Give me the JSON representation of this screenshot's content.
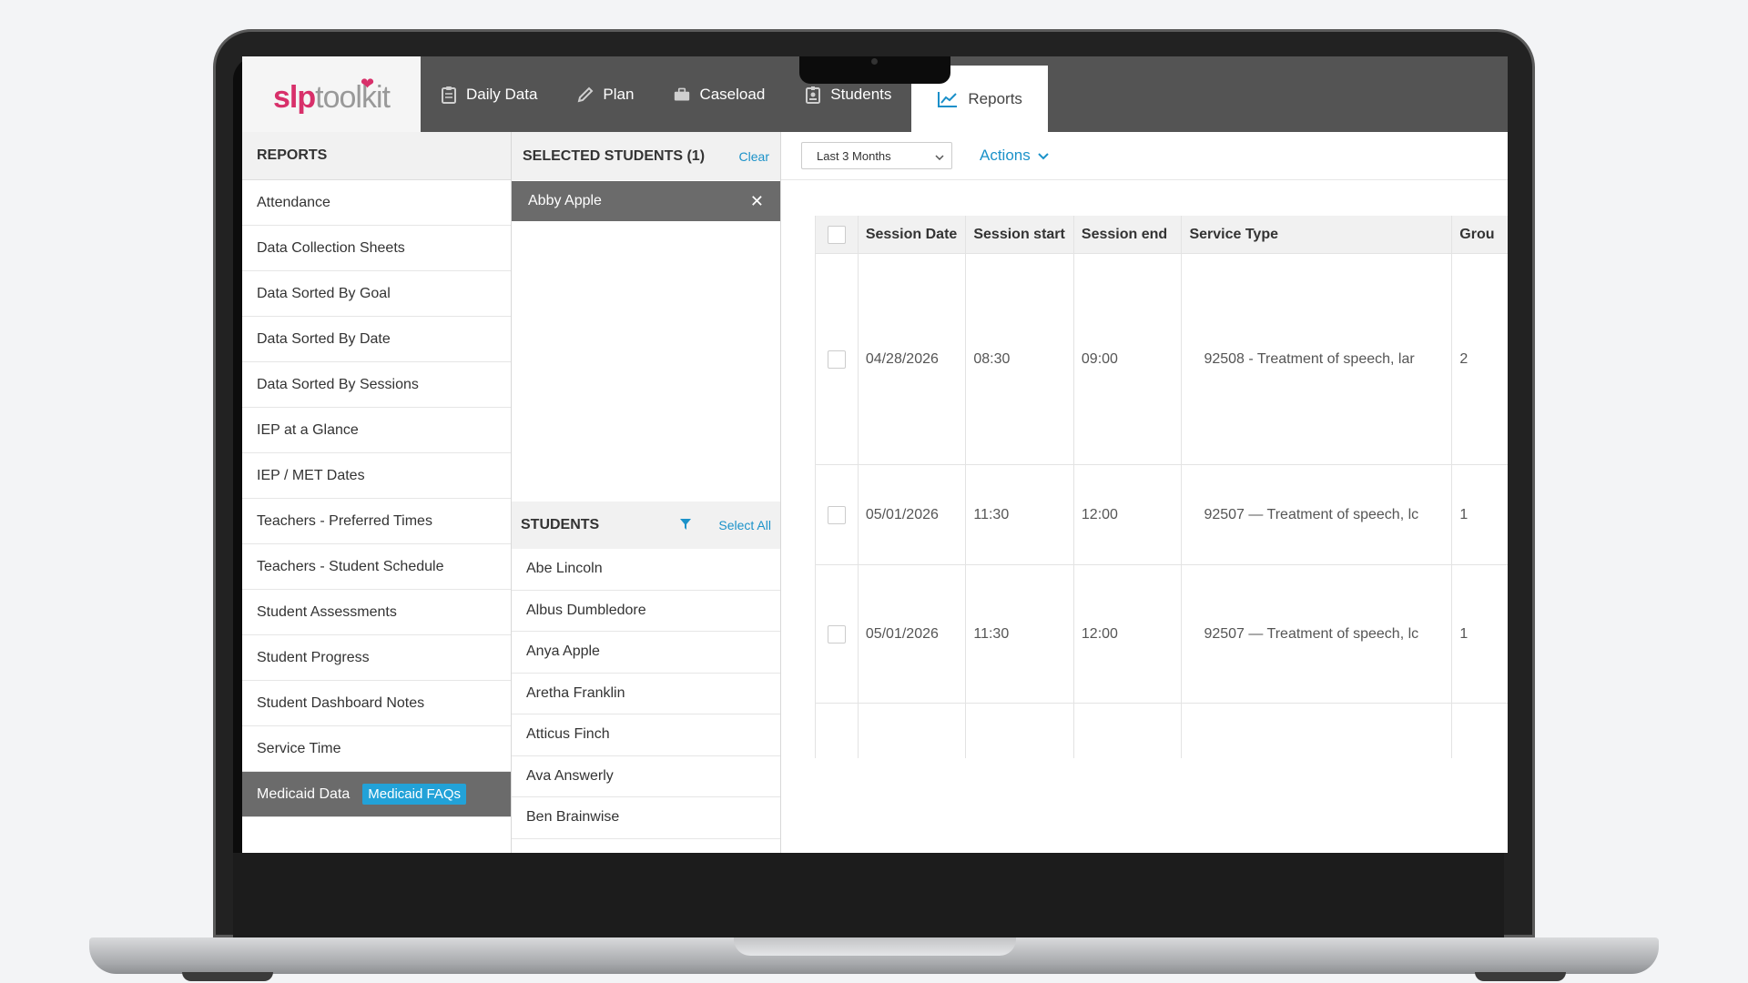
{
  "nav": {
    "logo_prefix": "slp",
    "logo_suffix": "toolkit",
    "tabs": [
      {
        "label": "Daily Data",
        "icon": "clipboard-icon"
      },
      {
        "label": "Plan",
        "icon": "pencil-icon"
      },
      {
        "label": "Caseload",
        "icon": "briefcase-icon"
      },
      {
        "label": "Students",
        "icon": "badge-icon"
      },
      {
        "label": "Reports",
        "icon": "chart-icon",
        "active": true
      }
    ]
  },
  "reports": {
    "title": "REPORTS",
    "items": [
      "Attendance",
      "Data Collection Sheets",
      "Data Sorted By Goal",
      "Data Sorted By Date",
      "Data Sorted By Sessions",
      "IEP at a Glance",
      "IEP / MET Dates",
      "Teachers - Preferred Times",
      "Teachers - Student Schedule",
      "Student Assessments",
      "Student Progress",
      "Student Dashboard Notes",
      "Service Time",
      "Medicaid Data"
    ],
    "active_badge": "Medicaid FAQs"
  },
  "selected": {
    "title": "SELECTED STUDENTS (1)",
    "clear_label": "Clear",
    "items": [
      "Abby Apple"
    ]
  },
  "students": {
    "title": "STUDENTS",
    "select_all_label": "Select All",
    "items": [
      "Abe Lincoln",
      "Albus Dumbledore",
      "Anya Apple",
      "Aretha Franklin",
      "Atticus Finch",
      "Ava Answerly",
      "Ben Brainwise"
    ]
  },
  "toolbar": {
    "range_value": "Last 3 Months",
    "actions_label": "Actions"
  },
  "table": {
    "headers": [
      "Session Date",
      "Session start",
      "Session end",
      "Service Type",
      "Grou"
    ],
    "rows": [
      [
        "04/28/2026",
        "08:30",
        "09:00",
        "92508 - Treatment of speech, lar",
        "2"
      ],
      [
        "05/01/2026",
        "11:30",
        "12:00",
        "92507 — Treatment of speech, lc",
        "1"
      ],
      [
        "05/01/2026",
        "11:30",
        "12:00",
        "92507 — Treatment of speech, lc",
        "1"
      ]
    ]
  },
  "colors": {
    "accent": "#1b92c9",
    "brand": "#d8306a",
    "nav_bg": "#545454",
    "active_item": "#6b6b6b"
  }
}
